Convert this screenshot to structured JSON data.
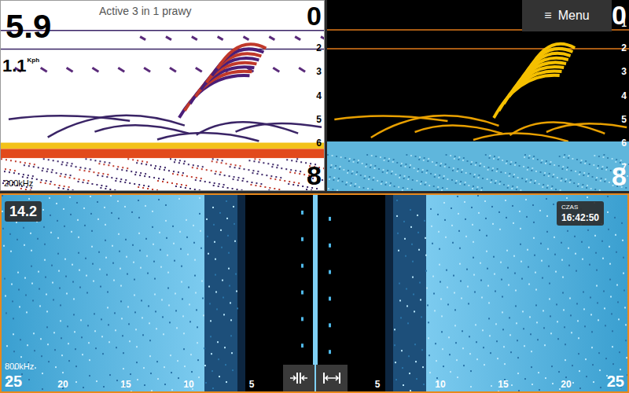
{
  "sonar_panel": {
    "title": "Active 3 in 1 prawy",
    "depth": "5.9",
    "speed": "1.1",
    "speed_unit": "Kph",
    "frequency": "200kHz",
    "scale": [
      "0",
      "2",
      "3",
      "4",
      "5",
      "6",
      "8"
    ]
  },
  "downscan_panel": {
    "menu_button": {
      "icon": "≡",
      "label": "Menu"
    },
    "scale": [
      "0",
      "1",
      "2",
      "3",
      "4",
      "5",
      "6",
      "7",
      "8"
    ]
  },
  "sidescan_panel": {
    "range": "14.2",
    "time": {
      "label": "CZAS",
      "value": "16:42:50"
    },
    "frequency": "800kHz",
    "scale": [
      "25",
      "20",
      "15",
      "10",
      "5",
      "5",
      "10",
      "15",
      "20",
      "25"
    ]
  }
}
